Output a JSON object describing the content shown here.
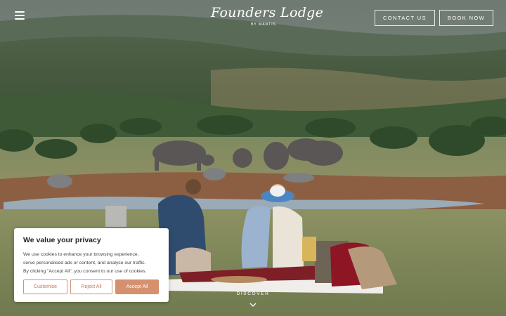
{
  "header": {
    "menu_icon": "hamburger-menu-icon",
    "logo": {
      "main": "Founders Lodge",
      "sub": "BY MANTIS"
    },
    "contact_label": "CONTACT US",
    "book_label": "BOOK NOW"
  },
  "hero": {
    "discover_label": "DISCOVER",
    "chevron_icon": "chevron-down-icon"
  },
  "cookie_banner": {
    "title": "We value your privacy",
    "lines": [
      "We use cookies to enhance your browsing experience,",
      "serve personalised ads or content, and analyse our traffic.",
      "By clicking \"Accept All\", you consent to our use of cookies."
    ],
    "customise_label": "Customise",
    "reject_label": "Reject All",
    "accept_label": "Accept All"
  },
  "colors": {
    "accent": "#d5906e",
    "header_text": "#ffffff"
  }
}
